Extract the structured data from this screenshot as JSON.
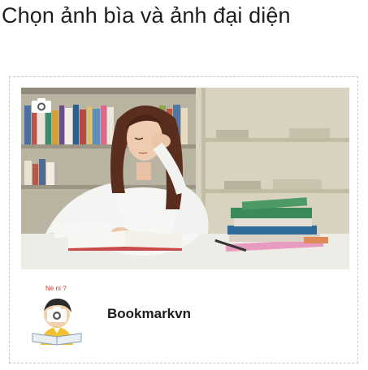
{
  "page": {
    "title": "Chọn ảnh bìa và ảnh đại diện"
  },
  "cover": {
    "camera_icon": "camera-icon"
  },
  "profile": {
    "avatar_caption": "Nè ní ?",
    "avatar_camera_icon": "camera-icon",
    "name": "Bookmarkvn"
  },
  "colors": {
    "card_border": "#c8c8c8",
    "title_text": "#1f1f1f",
    "name_text": "#1c1c1c"
  }
}
